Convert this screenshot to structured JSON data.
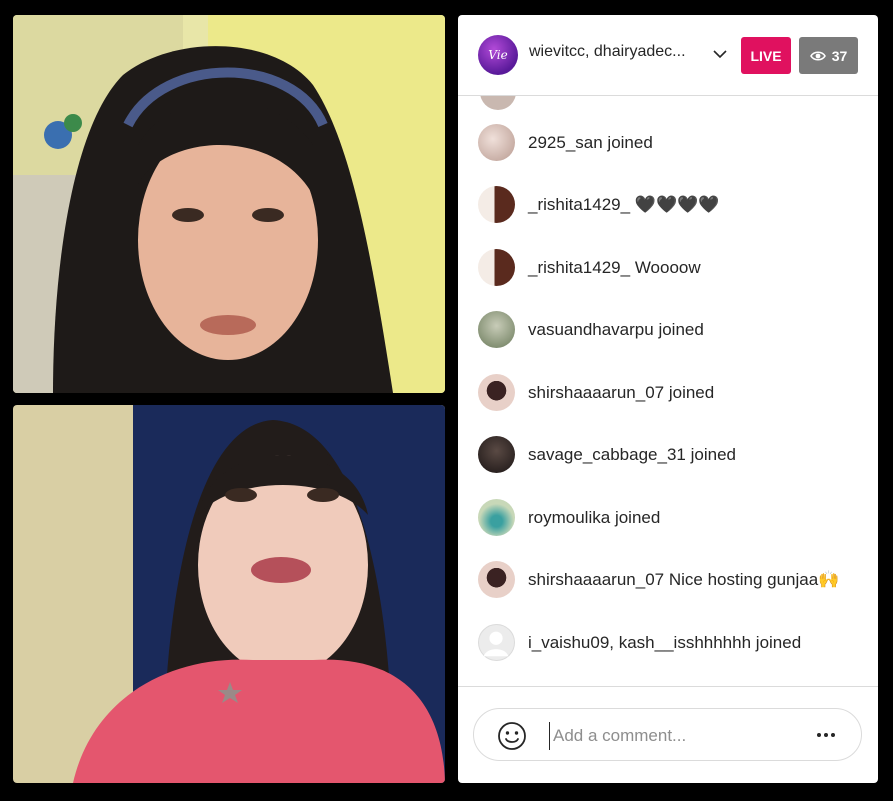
{
  "header": {
    "host_avatar_text": "Vie",
    "host_names": "wievitcc, dhairyadec...",
    "live_label": "LIVE",
    "viewer_count": "37"
  },
  "comments": [
    {
      "user": "2925_san",
      "message": "joined",
      "avatar_color": "#d9c2bb"
    },
    {
      "user": "_rishita1429_",
      "message": "🖤🖤🖤🖤",
      "avatar_color": "#6b3b2a"
    },
    {
      "user": "_rishita1429_",
      "message": "Woooow",
      "avatar_color": "#6b3b2a"
    },
    {
      "user": "vasuandhavarpu",
      "message": "joined",
      "avatar_color": "#8a9a7a"
    },
    {
      "user": "shirshaaaarun_07",
      "message": "joined",
      "avatar_color": "#7a3a3a"
    },
    {
      "user": "savage_cabbage_31",
      "message": "joined",
      "avatar_color": "#3a3030"
    },
    {
      "user": "roymoulika",
      "message": "joined",
      "avatar_color": "#9ab090"
    },
    {
      "user": "shirshaaaarun_07",
      "message": "Nice hosting gunjaa🙌",
      "avatar_color": "#7a3a3a"
    },
    {
      "user": "i_vaishu09, kash__isshhhhhh",
      "message": "joined",
      "avatar_color": "#e0e0e0"
    }
  ],
  "footer": {
    "comment_placeholder": "Add a comment..."
  }
}
